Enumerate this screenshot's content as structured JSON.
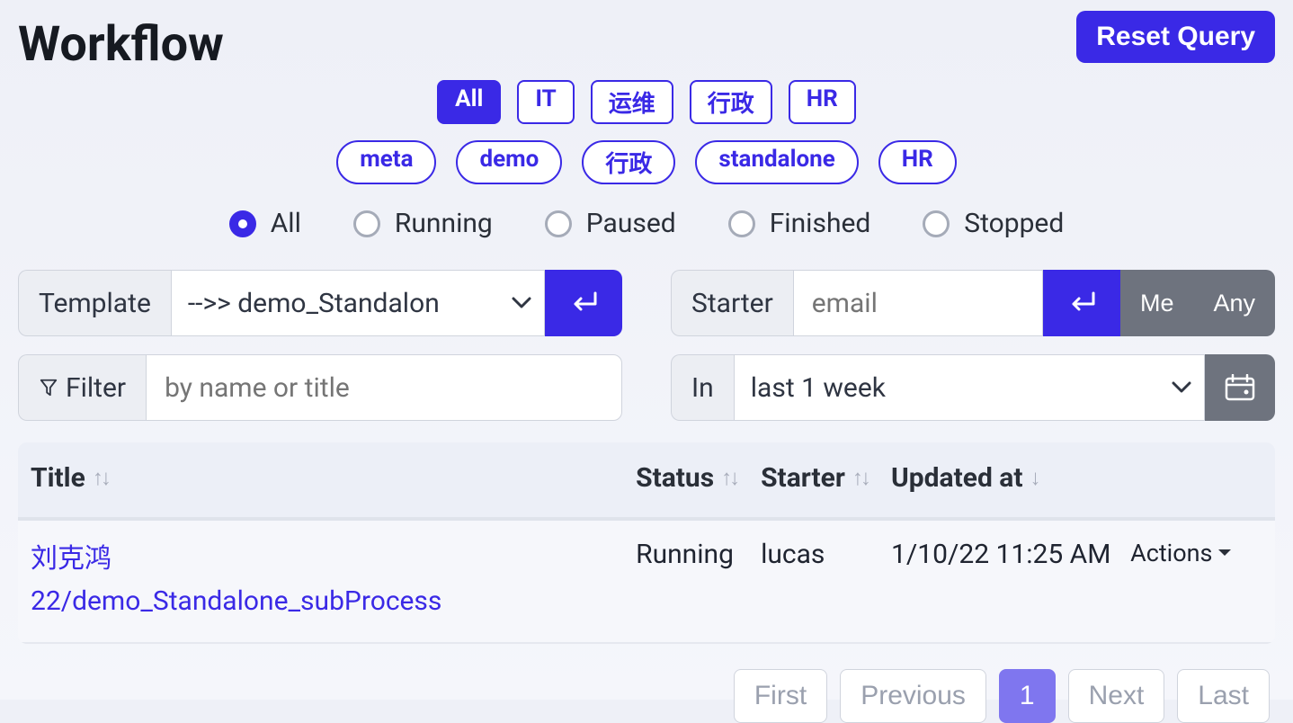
{
  "header": {
    "title": "Workflow",
    "reset_button": "Reset Query"
  },
  "categories": [
    {
      "label": "All",
      "active": true
    },
    {
      "label": "IT",
      "active": false
    },
    {
      "label": "运维",
      "active": false
    },
    {
      "label": "行政",
      "active": false
    },
    {
      "label": "HR",
      "active": false
    }
  ],
  "tags": [
    {
      "label": "meta"
    },
    {
      "label": "demo"
    },
    {
      "label": "行政"
    },
    {
      "label": "standalone"
    },
    {
      "label": "HR"
    }
  ],
  "status_filter": {
    "options": [
      "All",
      "Running",
      "Paused",
      "Finished",
      "Stopped"
    ],
    "selected": "All"
  },
  "template": {
    "label": "Template",
    "value": "-->> demo_Standalon"
  },
  "starter": {
    "label": "Starter",
    "placeholder": "email",
    "me_label": "Me",
    "any_label": "Any"
  },
  "filter": {
    "label": "Filter",
    "placeholder": "by name or title"
  },
  "timerange": {
    "label": "In",
    "value": "last 1 week"
  },
  "table": {
    "headers": {
      "title": "Title",
      "status": "Status",
      "starter": "Starter",
      "updated": "Updated at"
    },
    "rows": [
      {
        "title_line1": "刘克鸿",
        "title_line2": "22/demo_Standalone_subProcess",
        "status": "Running",
        "starter": "lucas",
        "updated": "1/10/22 11:25 AM",
        "actions_label": "Actions"
      }
    ]
  },
  "pagination": {
    "first": "First",
    "previous": "Previous",
    "current": "1",
    "next": "Next",
    "last": "Last"
  }
}
